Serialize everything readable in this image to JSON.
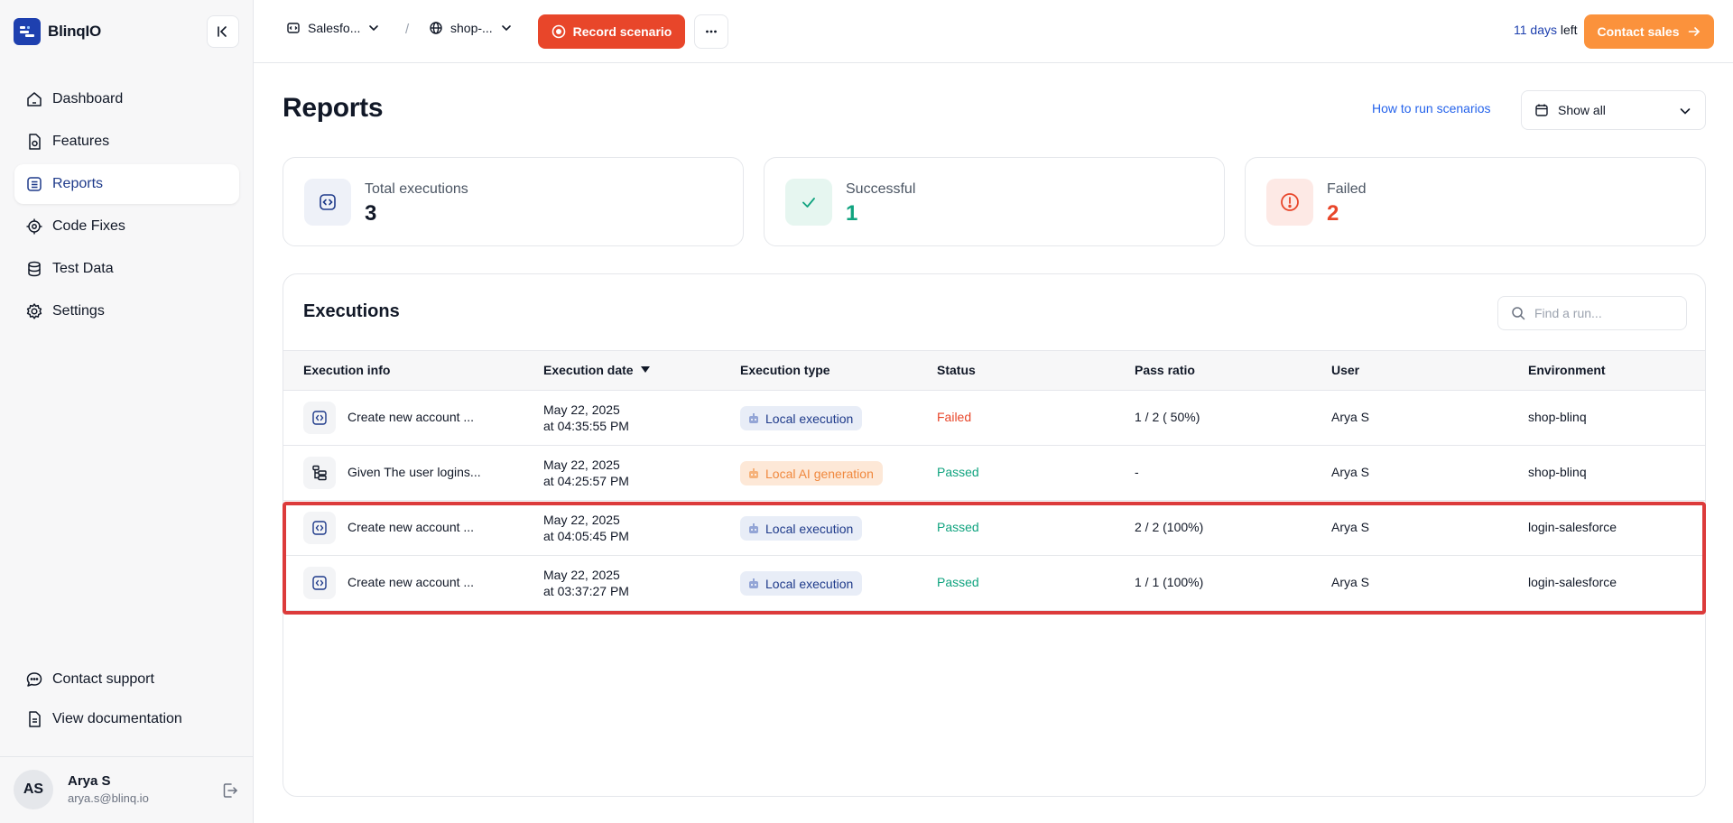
{
  "app": {
    "name": "BlinqIO"
  },
  "sidebar": {
    "items": [
      {
        "label": "Dashboard",
        "icon": "home-icon"
      },
      {
        "label": "Features",
        "icon": "feature-file-icon"
      },
      {
        "label": "Reports",
        "icon": "list-icon",
        "active": true
      },
      {
        "label": "Code Fixes",
        "icon": "gear-bug-icon"
      },
      {
        "label": "Test Data",
        "icon": "database-icon"
      },
      {
        "label": "Settings",
        "icon": "settings-icon"
      }
    ],
    "bottom": [
      {
        "label": "Contact support",
        "icon": "chat-icon"
      },
      {
        "label": "View documentation",
        "icon": "document-icon"
      }
    ],
    "user": {
      "initials": "AS",
      "name": "Arya S",
      "email": "arya.s@blinq.io"
    }
  },
  "topbar": {
    "project": "Salesfo...",
    "separator": "/",
    "environment": "shop-...",
    "record_label": "Record scenario",
    "trial_days": "11 days",
    "trial_suffix": " left",
    "contact_sales_label": "Contact sales"
  },
  "page": {
    "title": "Reports",
    "howto_link": "How to run scenarios",
    "filter_value": "Show all"
  },
  "stats": {
    "total": {
      "label": "Total executions",
      "value": "3",
      "color": "#111827"
    },
    "successful": {
      "label": "Successful",
      "value": "1",
      "color": "#10a37f"
    },
    "failed": {
      "label": "Failed",
      "value": "2",
      "color": "#e8462a"
    }
  },
  "executions": {
    "title": "Executions",
    "search_placeholder": "Find a run...",
    "columns": [
      "Execution info",
      "Execution date",
      "Execution type",
      "Status",
      "Pass ratio",
      "User",
      "Environment"
    ],
    "rows": [
      {
        "info": "Create new account ...",
        "date_line1": "May 22, 2025",
        "date_line2": "at 04:35:55 PM",
        "type": "Local execution",
        "type_kind": "local",
        "status": "Failed",
        "pass_ratio": "1 / 2 ( 50%)",
        "user": "Arya S",
        "environment": "shop-blinq",
        "icon": "code-icon"
      },
      {
        "info": "Given The user logins...",
        "date_line1": "May 22, 2025",
        "date_line2": "at 04:25:57 PM",
        "type": "Local AI generation",
        "type_kind": "ai",
        "status": "Passed",
        "pass_ratio": "-",
        "user": "Arya S",
        "environment": "shop-blinq",
        "icon": "steps-icon"
      },
      {
        "info": "Create new account ...",
        "date_line1": "May 22, 2025",
        "date_line2": "at 04:05:45 PM",
        "type": "Local execution",
        "type_kind": "local",
        "status": "Passed",
        "pass_ratio": "2 / 2 (100%)",
        "user": "Arya S",
        "environment": "login-salesforce",
        "icon": "code-icon"
      },
      {
        "info": "Create new account ...",
        "date_line1": "May 22, 2025",
        "date_line2": "at 03:37:27 PM",
        "type": "Local execution",
        "type_kind": "local",
        "status": "Passed",
        "pass_ratio": "1 / 1 (100%)",
        "user": "Arya S",
        "environment": "login-salesforce",
        "icon": "code-icon"
      }
    ]
  },
  "colors": {
    "accent": "#1e40af",
    "record": "#e8462a",
    "contact_sales": "#fb923c",
    "highlight": "#dc3b3b"
  }
}
